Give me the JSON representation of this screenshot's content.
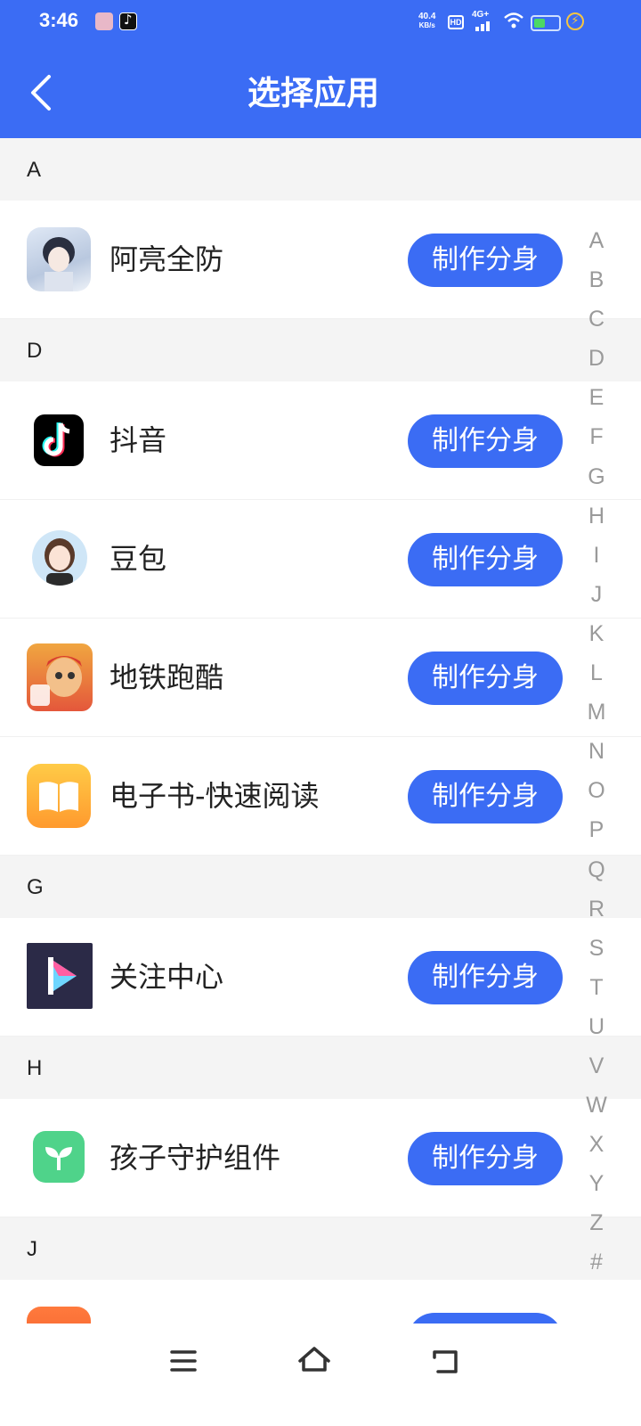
{
  "status_bar": {
    "time": "3:46",
    "speed_value": "40.4",
    "speed_unit": "KB/s",
    "hd": "HD",
    "network": "4G+"
  },
  "header": {
    "title": "选择应用",
    "back_icon": "chevron-left-icon"
  },
  "colors": {
    "accent": "#3b6cf4",
    "section_bg": "#f4f4f4",
    "index_text": "#9a9a9a"
  },
  "sections": [
    {
      "letter": "A",
      "apps": [
        {
          "name": "阿亮全防",
          "button": "制作分身",
          "icon": "anime-avatar-icon"
        }
      ]
    },
    {
      "letter": "D",
      "apps": [
        {
          "name": "抖音",
          "button": "制作分身",
          "icon": "tiktok-icon"
        },
        {
          "name": "豆包",
          "button": "制作分身",
          "icon": "doubao-avatar-icon"
        },
        {
          "name": "地铁跑酷",
          "button": "制作分身",
          "icon": "subway-surfers-icon"
        },
        {
          "name": "电子书-快速阅读",
          "button": "制作分身",
          "icon": "open-book-icon"
        }
      ]
    },
    {
      "letter": "G",
      "apps": [
        {
          "name": "关注中心",
          "button": "制作分身",
          "icon": "play-logo-icon"
        }
      ]
    },
    {
      "letter": "H",
      "apps": [
        {
          "name": "孩子守护组件",
          "button": "制作分身",
          "icon": "sprout-icon"
        }
      ]
    },
    {
      "letter": "J",
      "apps": [
        {
          "name": "",
          "button": "",
          "icon": "orange-app-icon"
        }
      ]
    }
  ],
  "index_letters": [
    "A",
    "B",
    "C",
    "D",
    "E",
    "F",
    "G",
    "H",
    "I",
    "J",
    "K",
    "L",
    "M",
    "N",
    "O",
    "P",
    "Q",
    "R",
    "S",
    "T",
    "U",
    "V",
    "W",
    "X",
    "Y",
    "Z",
    "#"
  ],
  "nav_bar": {
    "menu_icon": "menu-icon",
    "home_icon": "home-icon",
    "back_icon": "back-icon"
  }
}
